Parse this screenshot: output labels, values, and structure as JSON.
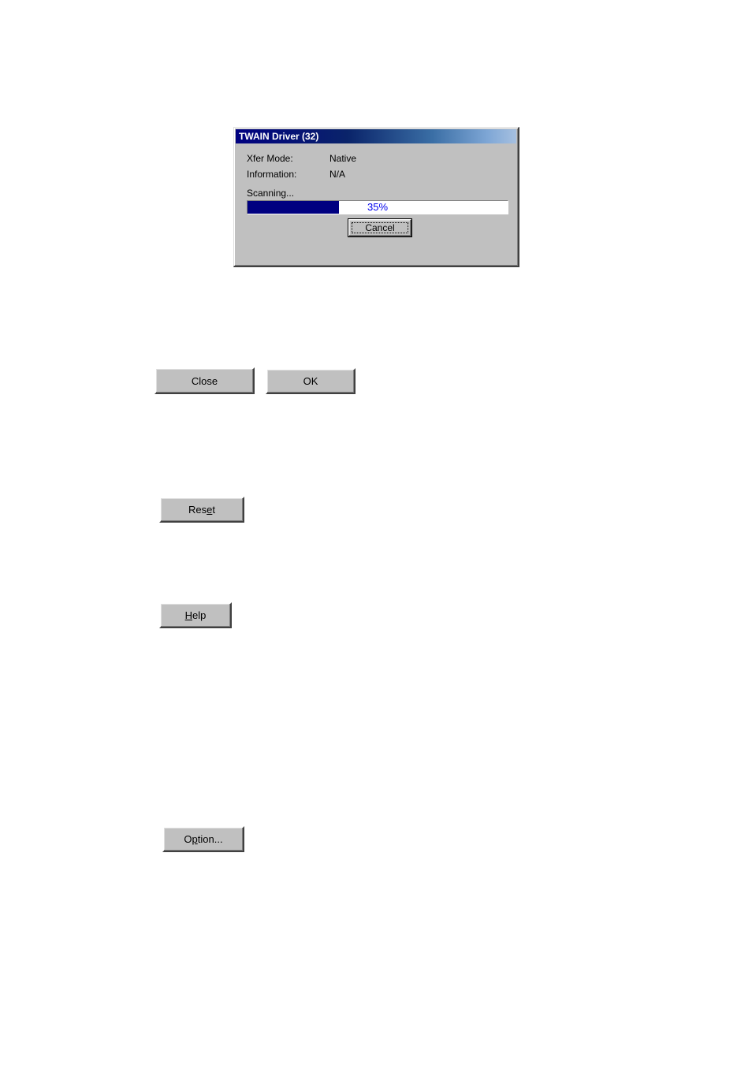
{
  "dialog": {
    "title": "TWAIN Driver (32)",
    "xfer_mode_label": "Xfer Mode:",
    "xfer_mode_value": "Native",
    "information_label": "Information:",
    "information_value": "N/A",
    "scanning_label": "Scanning...",
    "progress": {
      "percent": 35,
      "label": "35%"
    },
    "cancel_label": "Cancel"
  },
  "buttons": {
    "close": "Close",
    "ok": "OK",
    "reset_prefix": "Res",
    "reset_under": "e",
    "reset_suffix": "t",
    "help_under": "H",
    "help_suffix": "elp",
    "option_prefix": "O",
    "option_under": "p",
    "option_suffix": "tion..."
  }
}
